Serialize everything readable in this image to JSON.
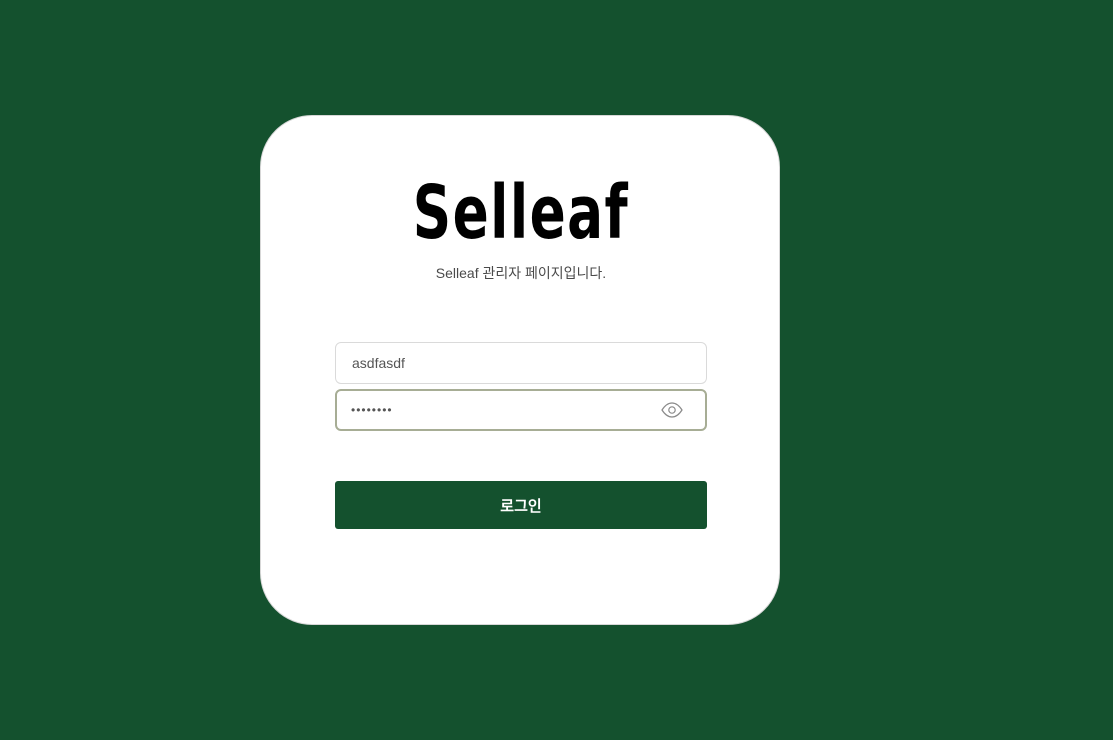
{
  "brand": {
    "logo_text": "Selleaf",
    "subtitle": "Selleaf 관리자 페이지입니다."
  },
  "form": {
    "id_value": "asdfasdf",
    "password_value": "asdfasdf",
    "password_toggle_icon": "eye-icon",
    "login_label": "로그인"
  },
  "colors": {
    "background": "#14512e",
    "card": "#ffffff",
    "button": "#14512e",
    "focus_border": "#a7ad95"
  }
}
